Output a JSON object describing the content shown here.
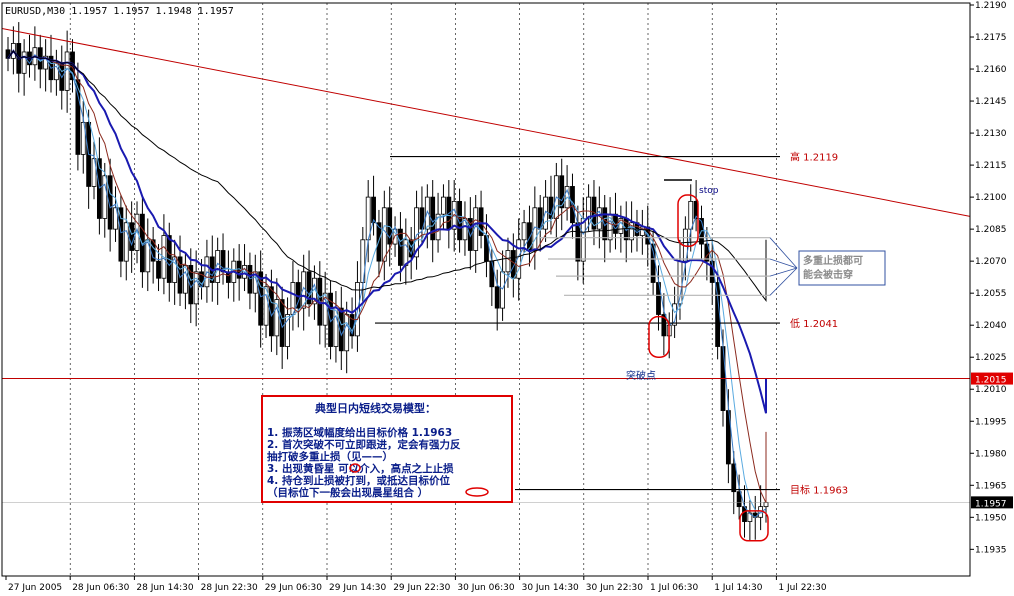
{
  "chart_data": {
    "type": "candlestick",
    "symbol_header": "EURUSD,M30  1.1957 1.1957 1.1948 1.1957",
    "y_axis": {
      "ylim": [
        1.193,
        1.219
      ],
      "ticks": [
        "1.2190",
        "1.2175",
        "1.2160",
        "1.2145",
        "1.2130",
        "1.2115",
        "1.2100",
        "1.2085",
        "1.2070",
        "1.2055",
        "1.2040",
        "1.2025",
        "1.2010",
        "1.1995",
        "1.1980",
        "1.1965",
        "1.1950",
        "1.1935"
      ]
    },
    "x_axis": {
      "ticks": [
        "27 Jun 2005",
        "28 Jun 06:30",
        "28 Jun 14:30",
        "28 Jun 22:30",
        "29 Jun 06:30",
        "29 Jun 14:30",
        "29 Jun 22:30",
        "30 Jun 06:30",
        "30 Jun 14:30",
        "30 Jun 22:30",
        "1 Jul 06:30",
        "1 Jul 14:30",
        "1 Jul 22:30"
      ]
    },
    "close_series": [
      1.2165,
      1.2172,
      1.2158,
      1.2168,
      1.2162,
      1.217,
      1.216,
      1.2166,
      1.2155,
      1.2163,
      1.215,
      1.2168,
      1.2155,
      1.212,
      1.2135,
      1.2105,
      1.2118,
      1.209,
      1.211,
      1.2085,
      1.2095,
      1.207,
      1.2088,
      1.2075,
      1.2092,
      1.2065,
      1.208,
      1.207,
      1.2062,
      1.2082,
      1.206,
      1.2072,
      1.2055,
      1.2068,
      1.205,
      1.2065,
      1.2058,
      1.2072,
      1.206,
      1.2075,
      1.2065,
      1.206,
      1.207,
      1.2062,
      1.2068,
      1.2055,
      1.2065,
      1.204,
      1.2058,
      1.2035,
      1.2052,
      1.203,
      1.2045,
      1.206,
      1.2048,
      1.2065,
      1.205,
      1.2062,
      1.204,
      1.2055,
      1.203,
      1.2048,
      1.2028,
      1.2045,
      1.2035,
      1.206,
      1.208,
      1.21,
      1.2088,
      1.207,
      1.2095,
      1.2078,
      1.2085,
      1.2068,
      1.208,
      1.2072,
      1.2095,
      1.2085,
      1.21,
      1.208,
      1.2092,
      1.21,
      1.2085,
      1.2098,
      1.208,
      1.209,
      1.2075,
      1.2095,
      1.2082,
      1.207,
      1.2058,
      1.2048,
      1.2065,
      1.2075,
      1.2062,
      1.208,
      1.2088,
      1.2075,
      1.2095,
      1.2085,
      1.21,
      1.209,
      1.211,
      1.2095,
      1.2105,
      1.2088,
      1.207,
      1.209,
      1.21,
      1.2085,
      1.2095,
      1.208,
      1.2092,
      1.2083,
      1.209,
      1.208,
      1.2088,
      1.2082,
      1.2086,
      1.2078,
      1.206,
      1.2045,
      1.2035,
      1.204,
      1.205,
      1.207,
      1.2085,
      1.2098,
      1.209,
      1.2078,
      1.207,
      1.206,
      1.203,
      1.2,
      1.1975,
      1.1962,
      1.1955,
      1.1948,
      1.1952,
      1.195,
      1.1955,
      1.1957
    ],
    "levels": [
      {
        "label": "高 1.2119",
        "value": 1.2119
      },
      {
        "label": "低 1.2041",
        "value": 1.2041
      },
      {
        "label": "目标 1.1963",
        "value": 1.1963
      },
      {
        "label": "1.2015",
        "value": 1.2015
      }
    ],
    "current_price": "1.1957"
  },
  "annotations": {
    "stop": "stop",
    "breakout": "突破点",
    "note_lines": [
      "多重止损都可",
      "能会被击穿"
    ]
  },
  "infobox": {
    "title": "典型日内短线交易模型：",
    "lines": [
      "1. 振荡区域幅度给出目标价格 1.1963",
      "2. 首次突破不可立即跟进，定会有强力反",
      "   抽打破多重止损（见——）",
      "3. 出现黄昏星   可以介入，高点之上止损",
      "4. 持仓到止损被打到，或抵达目标价位",
      "  （目标位下一般会出现晨星组合       ）"
    ]
  },
  "colors": {
    "up": "#000000",
    "down": "#000000",
    "ma_fast": "#3a7cc8",
    "ma_mid": "#8b2a1e",
    "ma_slow": "#1a1ab0",
    "ma_long": "#000000",
    "trendline": "#c00000",
    "highlight": "#cc0000",
    "level_line": "#000000"
  }
}
